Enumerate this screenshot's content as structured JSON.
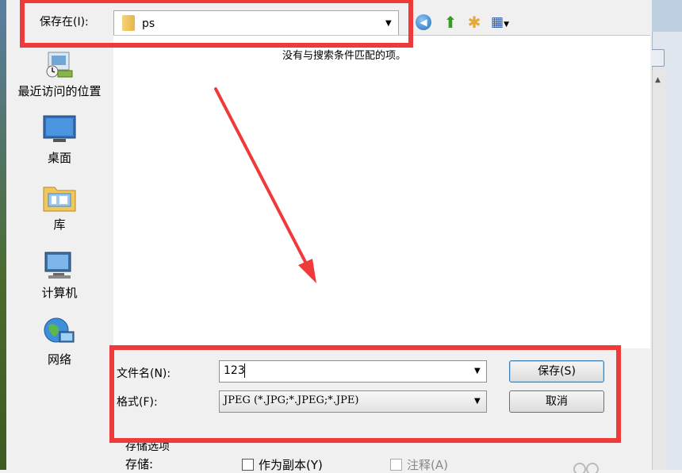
{
  "top_bar": {
    "save_in_label": "保存在(I):",
    "folder_name": "ps"
  },
  "sidebar": {
    "items": [
      {
        "label": "最近访问的位置",
        "icon": "recent-places-icon"
      },
      {
        "label": "桌面",
        "icon": "desktop-icon"
      },
      {
        "label": "库",
        "icon": "libraries-icon"
      },
      {
        "label": "计算机",
        "icon": "computer-icon"
      },
      {
        "label": "网络",
        "icon": "network-icon"
      }
    ]
  },
  "file_area": {
    "empty_message": "没有与搜索条件匹配的项。"
  },
  "form": {
    "filename_label": "文件名(N):",
    "filename_value": "123",
    "format_label": "格式(F):",
    "format_value": "JPEG (*.JPG;*.JPEG;*.JPE)"
  },
  "buttons": {
    "save": "保存(S)",
    "cancel": "取消"
  },
  "save_options": {
    "title": "存储选项",
    "save_label": "存储:",
    "as_copy": "作为副本(Y)",
    "notes": "注释(A)"
  },
  "colors": {
    "annotation_red": "#f03a3a",
    "save_button_border": "#3c7fb1"
  }
}
